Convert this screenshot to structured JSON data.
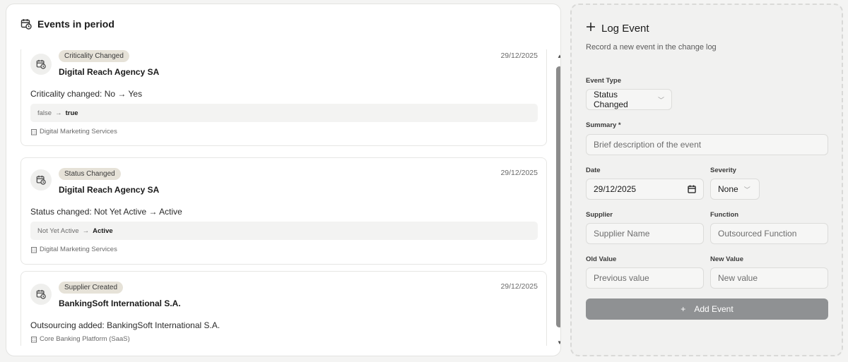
{
  "events_panel": {
    "title": "Events in period",
    "icon": "calendar-clock-icon",
    "events": [
      {
        "badge": "Criticality Changed",
        "supplier": "Digital Reach Agency SA",
        "date": "29/12/2025",
        "summary": "Criticality changed: No → Yes",
        "old_value": "false",
        "new_value": "true",
        "function": "Digital Marketing Services"
      },
      {
        "badge": "Status Changed",
        "supplier": "Digital Reach Agency SA",
        "date": "29/12/2025",
        "summary": "Status changed: Not Yet Active → Active",
        "old_value": "Not Yet Active",
        "new_value": "Active",
        "function": "Digital Marketing Services"
      },
      {
        "badge": "Supplier Created",
        "supplier": "BankingSoft International S.A.",
        "date": "29/12/2025",
        "summary": "Outsourcing added: BankingSoft International S.A.",
        "function": "Core Banking Platform (SaaS)"
      }
    ],
    "diff_arrow": "→"
  },
  "log_form": {
    "title": "Log Event",
    "subtitle": "Record a new event in the change log",
    "event_type": {
      "label": "Event Type",
      "value": "Status Changed"
    },
    "summary": {
      "label": "Summary *",
      "placeholder": "Brief description of the event"
    },
    "date": {
      "label": "Date",
      "value": "29/12/2025"
    },
    "severity": {
      "label": "Severity",
      "value": "None"
    },
    "supplier": {
      "label": "Supplier",
      "placeholder": "Supplier Name"
    },
    "function": {
      "label": "Function",
      "placeholder": "Outsourced Function"
    },
    "old_value": {
      "label": "Old Value",
      "placeholder": "Previous value"
    },
    "new_value": {
      "label": "New Value",
      "placeholder": "New value"
    },
    "submit": {
      "label": "Add Event",
      "plus": "+"
    }
  },
  "colors": {
    "badge_bg": "#e6e2d8",
    "submit_bg": "#8f9193",
    "scroll_thumb": "#8b8b8b"
  }
}
